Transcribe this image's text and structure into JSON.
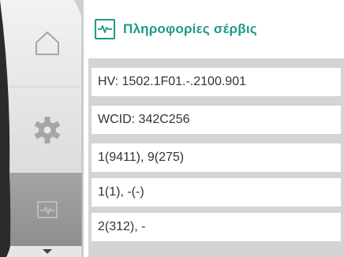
{
  "header": {
    "title": "Πληροφορίες σέρβις",
    "icon": "pulse-icon"
  },
  "sidebar": {
    "items": [
      {
        "icon": "home-icon",
        "state": "inactive"
      },
      {
        "icon": "gear-icon",
        "state": "inactive"
      },
      {
        "icon": "pulse-icon",
        "state": "selected"
      }
    ],
    "scroll_indicator": "chevron-down-icon"
  },
  "info_rows": [
    {
      "text": "HV: 1502.1F01.-.2100.901"
    },
    {
      "text": "WCID: 342C256"
    },
    {
      "text": "1(9411), 9(275)"
    },
    {
      "text": "1(1), -(-)"
    },
    {
      "text": "2(312), -"
    }
  ],
  "colors": {
    "accent": "#1e9a8a",
    "rail_top": "#e9e9e9",
    "rail_selected": "#9a9a9a",
    "list_background": "#d4d4d4",
    "row_background": "#ffffff",
    "text": "#333333"
  }
}
